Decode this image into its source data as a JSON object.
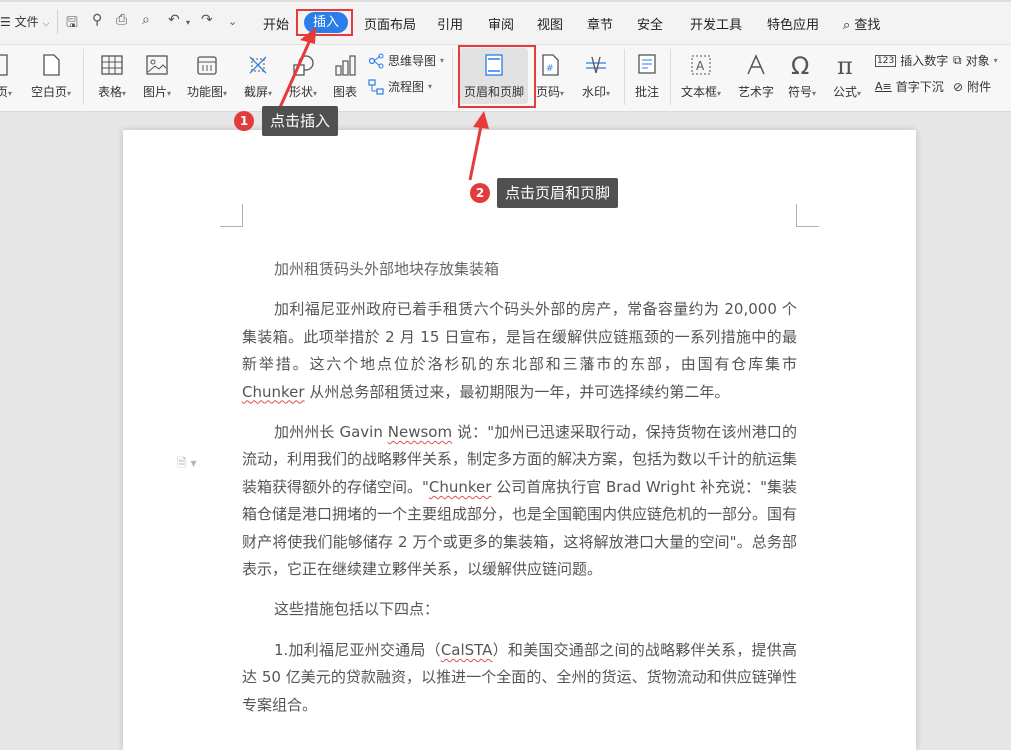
{
  "menubar": {
    "file_label": "文件",
    "tabs": [
      "开始",
      "插入",
      "页面布局",
      "引用",
      "审阅",
      "视图",
      "章节",
      "安全",
      "开发工具",
      "特色应用"
    ],
    "active_tab": "插入",
    "find_label": "查找"
  },
  "ribbon": {
    "page_label": "页",
    "blank_page": "空白页",
    "table": "表格",
    "picture": "图片",
    "function_chart": "功能图",
    "screenshot": "截屏",
    "shape": "形状",
    "chart": "图表",
    "mind_map": "思维导图",
    "flowchart": "流程图",
    "header_footer": "页眉和页脚",
    "page_number": "页码",
    "watermark": "水印",
    "comment": "批注",
    "textbox": "文本框",
    "art_text": "艺术字",
    "symbol": "符号",
    "formula": "公式",
    "insert_number": "插入数字",
    "object": "对象",
    "drop_cap": "首字下沉",
    "attachment": "附件"
  },
  "callouts": {
    "step1_num": "1",
    "step1_text": "点击插入",
    "step2_num": "2",
    "step2_text": "点击页眉和页脚"
  },
  "document": {
    "title": "加州租赁码头外部地块存放集装箱",
    "p1_a": "加利福尼亚州政府已着手租赁六个码头外部的房产，常备容量约为 20,000 个集装箱。此项举措於 2 月 15 日宣布，是旨在缓解供应链瓶颈的一系列措施中的最新举措。这六个地点位於洛杉矶的东北部和三藩市的东部，由国有仓库集市 ",
    "p1_chunker": "Chunker",
    "p1_b": " 从州总务部租赁过来，最初期限为一年，并可选择续约第二年。",
    "p2_a": "加州州长 Gavin ",
    "p2_newsom": "Newsom",
    "p2_b": " 说：\"加州已迅速采取行动，保持货物在该州港口的流动，利用我们的战略夥伴关系，制定多方面的解决方案，包括为数以千计的航运集装箱获得额外的存储空间。\"",
    "p2_chunker": "Chunker",
    "p2_c": " 公司首席执行官 Brad Wright 补充说：\"集装箱仓储是港口拥堵的一个主要组成部分，也是全国範围内供应链危机的一部分。国有财产将使我们能够储存 2 万个或更多的集装箱，这将解放港口大量的空间\"。总务部表示，它正在继续建立夥伴关系，以缓解供应链问题。",
    "p3": "这些措施包括以下四点：",
    "p4_a": "1.加利福尼亚州交通局（",
    "p4_calsta": "CalSTA",
    "p4_b": "）和美国交通部之间的战略夥伴关系，提供高达 50 亿美元的贷款融资，以推进一个全面的、全州的货运、货物流动和供应链弹性专案组合。"
  },
  "colors": {
    "accent_blue": "#2b7de9",
    "highlight_red": "#e53b3b",
    "callout_bg": "#505050"
  }
}
